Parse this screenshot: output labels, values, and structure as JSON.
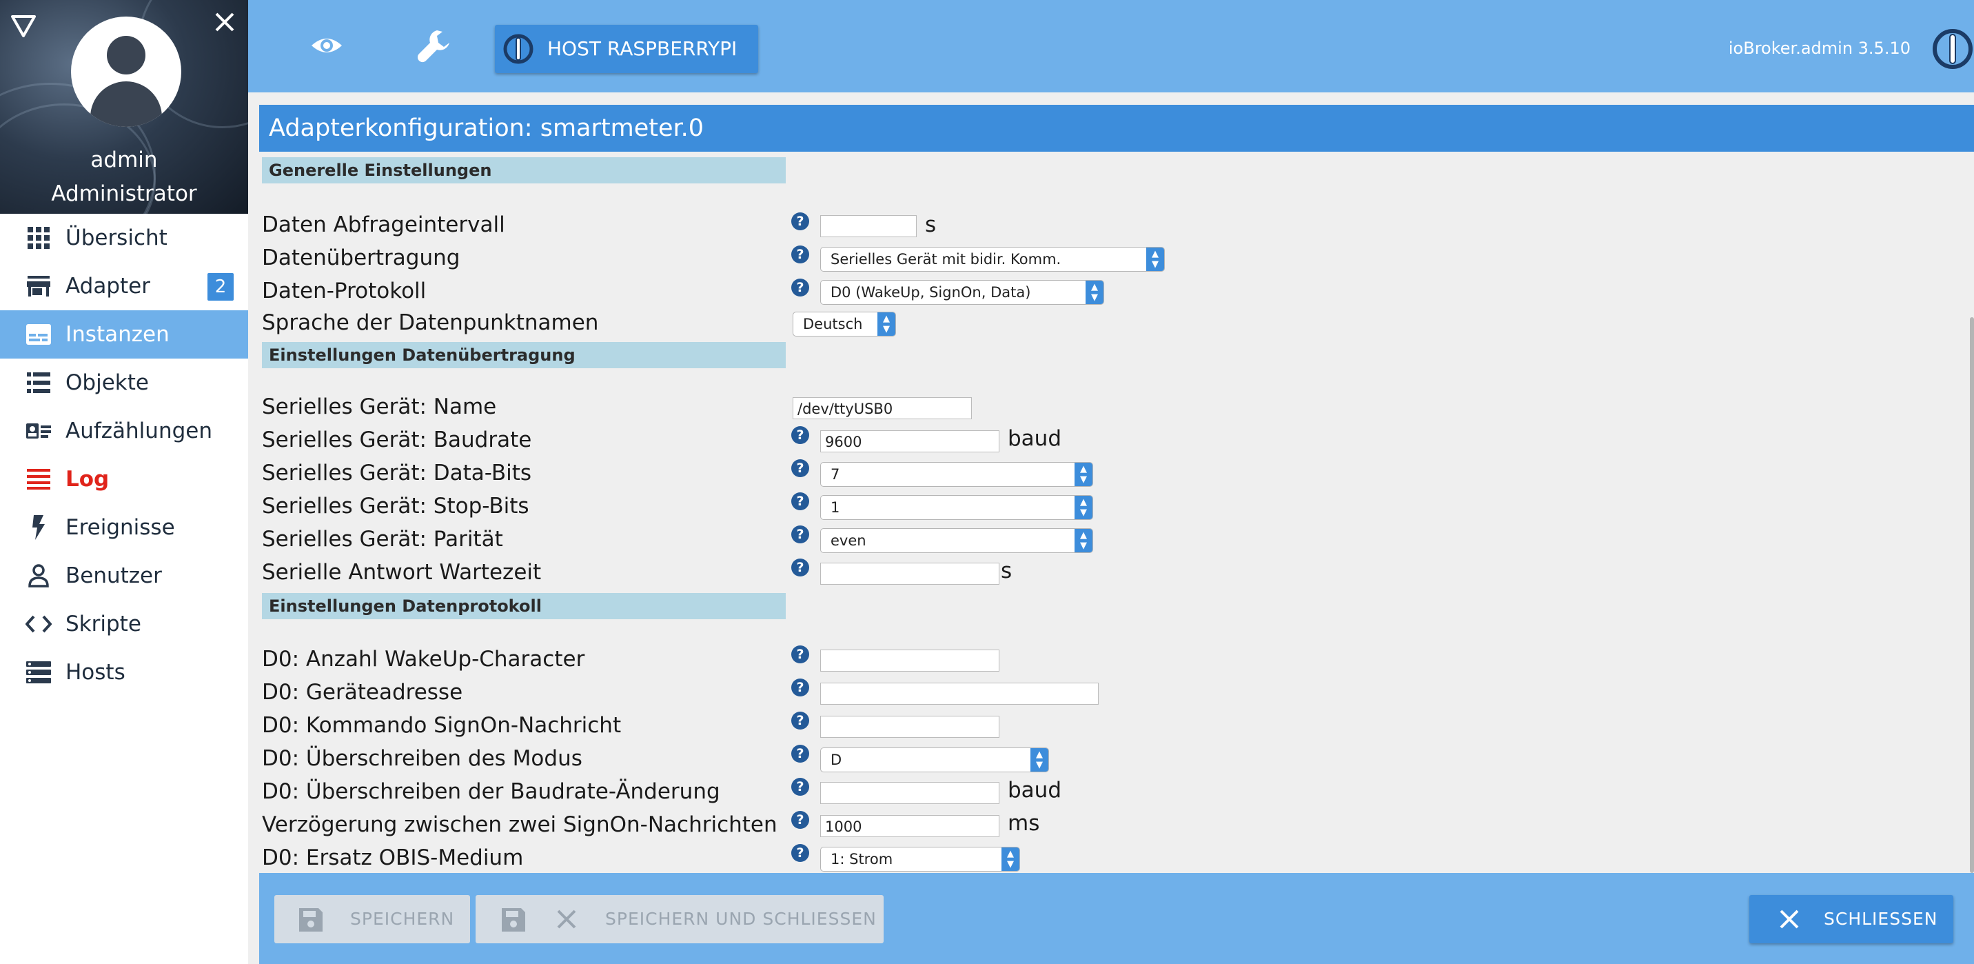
{
  "sidebar": {
    "user_name": "admin",
    "user_role": "Administrator",
    "items": [
      {
        "label": "Übersicht"
      },
      {
        "label": "Adapter",
        "badge": "2"
      },
      {
        "label": "Instanzen"
      },
      {
        "label": "Objekte"
      },
      {
        "label": "Aufzählungen"
      },
      {
        "label": "Log"
      },
      {
        "label": "Ereignisse"
      },
      {
        "label": "Benutzer"
      },
      {
        "label": "Skripte"
      },
      {
        "label": "Hosts"
      }
    ]
  },
  "topbar": {
    "host_label": "HOST RASPBERRYPI",
    "version": "ioBroker.admin 3.5.10"
  },
  "config": {
    "title": "Adapterkonfiguration: smartmeter.0",
    "sections": {
      "general": "Generelle Einstellungen",
      "transport": "Einstellungen Datenübertragung",
      "protocol": "Einstellungen Datenprotokoll"
    },
    "fields": {
      "interval_label": "Daten Abfrageintervall",
      "interval_value": "",
      "interval_unit": "s",
      "transport_label": "Datenübertragung",
      "transport_value": "Serielles Gerät mit bidir. Komm.",
      "protocol_label": "Daten-Protokoll",
      "protocol_value": "D0 (WakeUp, SignOn, Data)",
      "language_label": "Sprache der Datenpunktnamen",
      "language_value": "Deutsch",
      "serial_name_label": "Serielles Gerät: Name",
      "serial_name_value": "/dev/ttyUSB0",
      "baudrate_label": "Serielles Gerät: Baudrate",
      "baudrate_value": "9600",
      "baudrate_unit": "baud",
      "databits_label": "Serielles Gerät: Data-Bits",
      "databits_value": "7",
      "stopbits_label": "Serielles Gerät: Stop-Bits",
      "stopbits_value": "1",
      "parity_label": "Serielles Gerät: Parität",
      "parity_value": "even",
      "wait_label": "Serielle Antwort Wartezeit",
      "wait_value": "",
      "wait_unit": "s",
      "wakeup_label": "D0: Anzahl WakeUp-Character",
      "wakeup_value": "",
      "address_label": "D0: Geräteadresse",
      "address_value": "",
      "signon_label": "D0: Kommando SignOn-Nachricht",
      "signon_value": "",
      "mode_label": "D0: Überschreiben des Modus",
      "mode_value": "D",
      "baudchange_label": "D0: Überschreiben der Baudrate-Änderung",
      "baudchange_value": "",
      "baudchange_unit": "baud",
      "delay_label": "Verzögerung zwischen zwei SignOn-Nachrichten",
      "delay_value": "1000",
      "delay_unit": "ms",
      "medium_label": "D0: Ersatz OBIS-Medium",
      "medium_value": "1: Strom"
    }
  },
  "buttons": {
    "save": "SPEICHERN",
    "save_close": "SPEICHERN UND SCHLIESSEN",
    "close": "SCHLIESSEN"
  },
  "colors": {
    "accent": "#3d8ddb",
    "topbar": "#6fb0ea",
    "section": "#b4d7e4",
    "log_red": "#e0241b"
  }
}
